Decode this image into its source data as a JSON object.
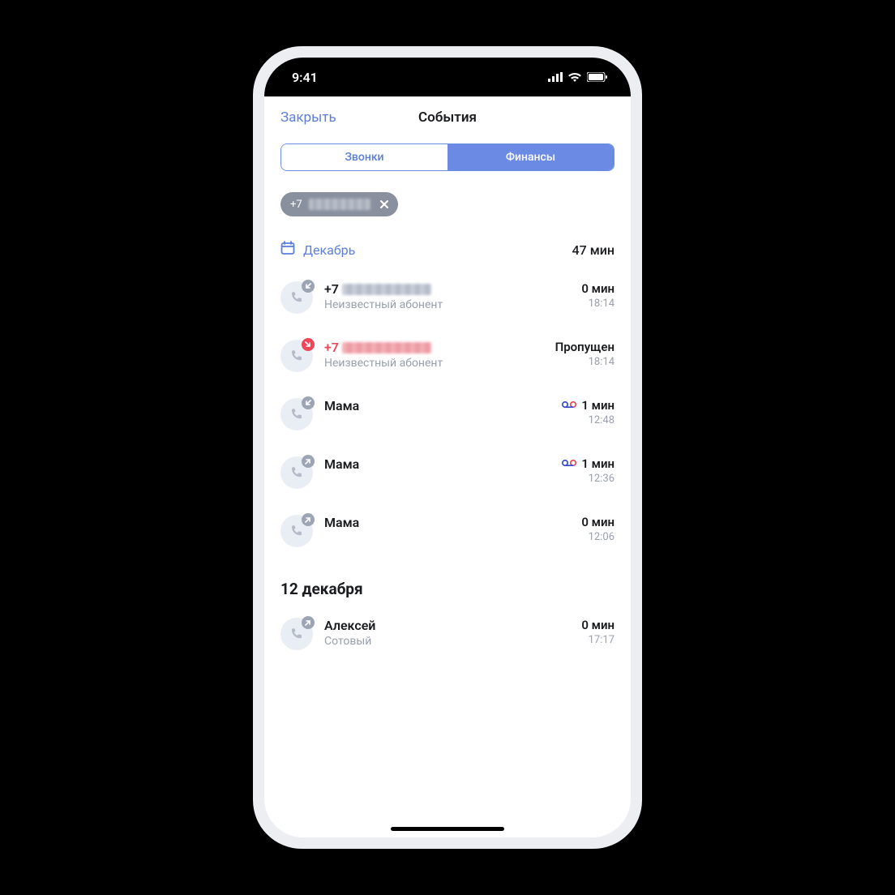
{
  "status": {
    "time": "9:41"
  },
  "header": {
    "close": "Закрыть",
    "title": "События"
  },
  "tabs": {
    "calls": "Звонки",
    "finance": "Финансы"
  },
  "filter_chip": {
    "prefix": "+7"
  },
  "month": {
    "label": "Декабрь",
    "total": "47 мин"
  },
  "calls": [
    {
      "title_prefix": "+7",
      "redacted": true,
      "missed": false,
      "sub": "Неизвестный абонент",
      "duration": "0 мин",
      "time": "18:14",
      "dir": "in",
      "vm": false
    },
    {
      "title_prefix": "+7",
      "redacted": true,
      "missed": true,
      "sub": "Неизвестный абонент",
      "duration": "Пропущен",
      "time": "18:14",
      "dir": "miss",
      "vm": false
    },
    {
      "title": "Мама",
      "missed": false,
      "sub": "",
      "duration": "1 мин",
      "time": "12:48",
      "dir": "in",
      "vm": true
    },
    {
      "title": "Мама",
      "missed": false,
      "sub": "",
      "duration": "1 мин",
      "time": "12:36",
      "dir": "out",
      "vm": true
    },
    {
      "title": "Мама",
      "missed": false,
      "sub": "",
      "duration": "0 мин",
      "time": "12:06",
      "dir": "out",
      "vm": false
    }
  ],
  "section2": {
    "header": "12 декабря"
  },
  "calls2": [
    {
      "title": "Алексей",
      "missed": false,
      "sub": "Сотовый",
      "duration": "0 мин",
      "time": "17:17",
      "dir": "out",
      "vm": false
    }
  ]
}
